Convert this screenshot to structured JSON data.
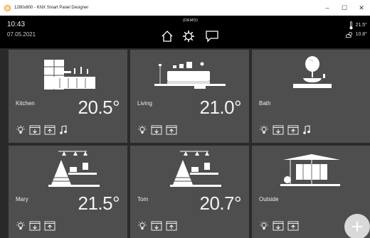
{
  "window": {
    "title": "1280x800 - KNX Smart Panel Designer",
    "minimize": "–",
    "maximize": "☐",
    "close": "✕"
  },
  "header": {
    "time": "10:43",
    "date": "07.05.2021",
    "demo_label": "(DEMO)",
    "indoor_temp": "21.5°",
    "outdoor_temp": "10.8°",
    "nav_icons": [
      "home-icon",
      "gear-icon",
      "chat-icon"
    ]
  },
  "rooms": [
    {
      "name": "Kitchen",
      "temp": "20.5°",
      "controls": [
        "light",
        "blind-down",
        "blind-up",
        "music"
      ]
    },
    {
      "name": "Living",
      "temp": "21.0°",
      "controls": [
        "light",
        "blind-down",
        "blind-up"
      ]
    },
    {
      "name": "Bath",
      "temp": "",
      "controls": [
        "light",
        "blind-down",
        "blind-up",
        "music"
      ]
    },
    {
      "name": "Mary",
      "temp": "21.5°",
      "controls": [
        "light",
        "blind-down",
        "blind-up"
      ]
    },
    {
      "name": "Tom",
      "temp": "20.7°",
      "controls": [
        "light",
        "blind-down",
        "blind-up"
      ]
    },
    {
      "name": "Outside",
      "temp": "",
      "controls": [
        "light",
        "blind-down",
        "blind-up"
      ]
    }
  ],
  "fab": {
    "icon": "plus-icon"
  },
  "colors": {
    "tile": "#4e4e4e",
    "background": "#2a2a2a",
    "header": "#000000"
  }
}
